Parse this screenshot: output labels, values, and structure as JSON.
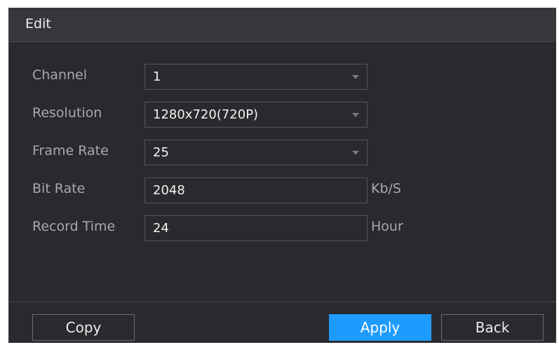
{
  "dialog": {
    "title": "Edit"
  },
  "form": {
    "channel": {
      "label": "Channel",
      "value": "1"
    },
    "resolution": {
      "label": "Resolution",
      "value": "1280x720(720P)"
    },
    "frame_rate": {
      "label": "Frame Rate",
      "value": "25"
    },
    "bit_rate": {
      "label": "Bit Rate",
      "value": "2048",
      "unit": "Kb/S"
    },
    "record_time": {
      "label": "Record Time",
      "value": "24",
      "unit": "Hour"
    }
  },
  "buttons": {
    "copy": "Copy",
    "apply": "Apply",
    "back": "Back"
  },
  "colors": {
    "primary": "#1e9bff",
    "background": "#2a2a2e",
    "titlebar": "#36363b"
  }
}
